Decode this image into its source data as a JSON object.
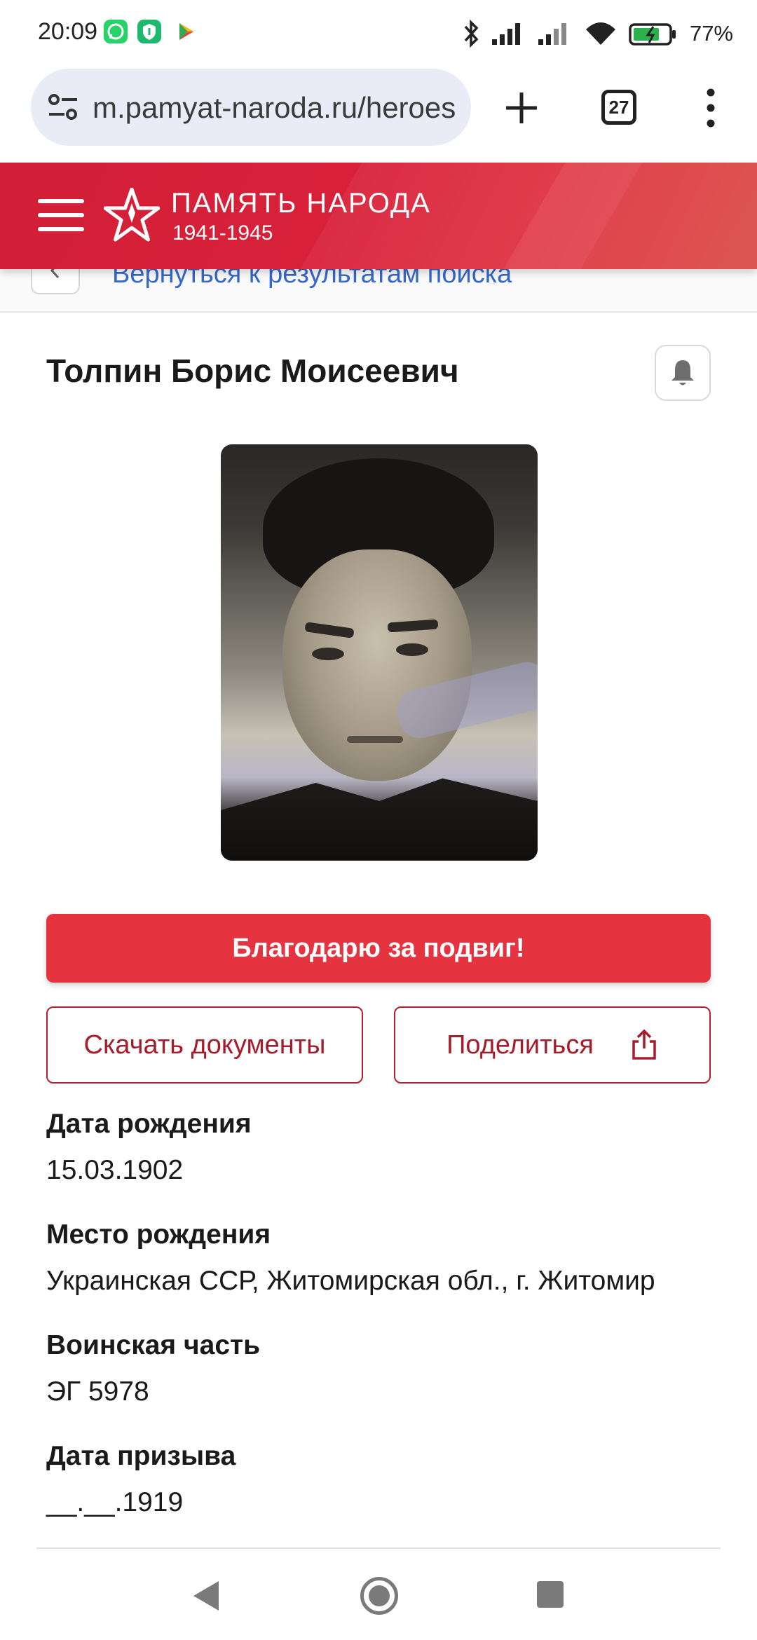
{
  "status_bar": {
    "time": "20:09",
    "battery": "77%",
    "apps": [
      {
        "icon": "whatsapp-icon",
        "color": "#25d366"
      },
      {
        "icon": "shield-app-icon",
        "color": "#1fb86f"
      },
      {
        "icon": "play-store-icon",
        "color": "#4285f4"
      }
    ]
  },
  "browser": {
    "url": "m.pamyat-naroda.ru/heroes",
    "tabs_count": "27"
  },
  "site_header": {
    "brand_title": "ПАМЯТЬ НАРОДА",
    "brand_years": "1941-1945",
    "accent_color": "#d31f38"
  },
  "navigation": {
    "back_link": "Вернуться к результатам поиска"
  },
  "hero": {
    "name": "Толпин Борис Моисеевич"
  },
  "actions": {
    "thanks": "Благодарю за подвиг!",
    "download": "Скачать документы",
    "share": "Поделиться"
  },
  "details": [
    {
      "label": "Дата рождения",
      "value": "15.03.1902"
    },
    {
      "label": "Место рождения",
      "value": "Украинская ССР, Житомирская обл., г. Житомир"
    },
    {
      "label": "Воинская часть",
      "value": "ЭГ 5978"
    },
    {
      "label": "Дата призыва",
      "value": "__.__.1919"
    }
  ]
}
